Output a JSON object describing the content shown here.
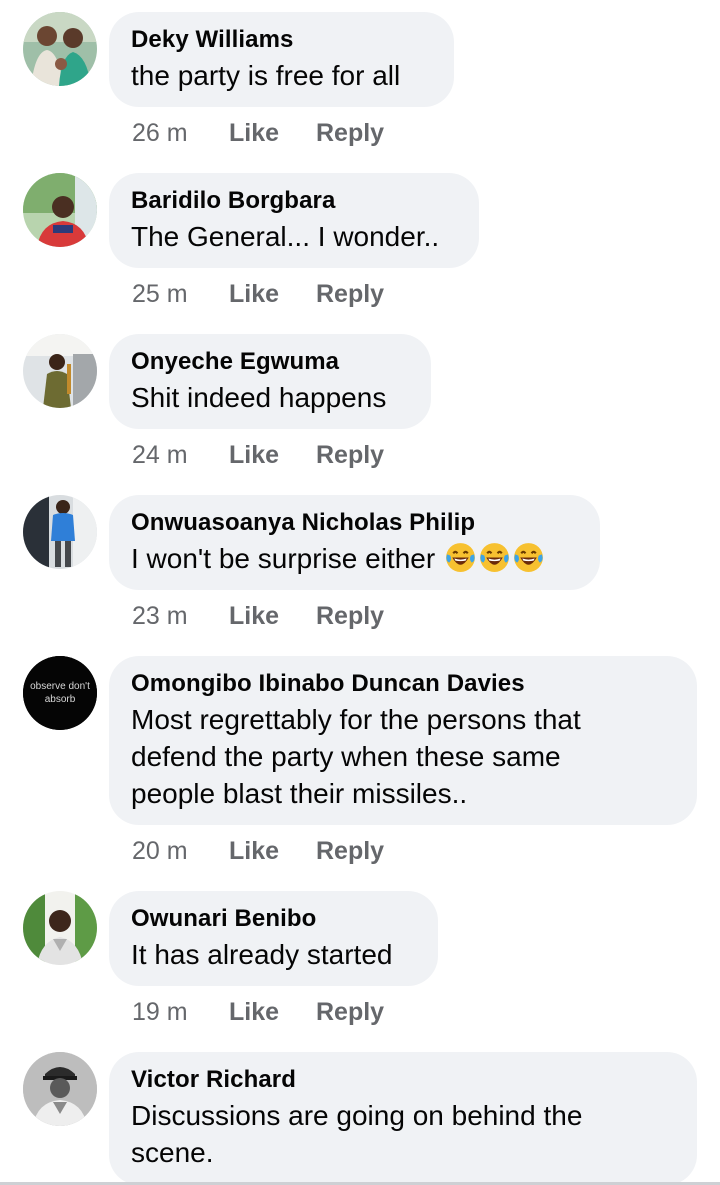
{
  "comments": [
    {
      "author": "Deky Williams",
      "text": "the party is free for all",
      "time": "26 m",
      "like": "Like",
      "reply": "Reply",
      "avatar": "avatar-couple-photo"
    },
    {
      "author": "Baridilo Borgbara",
      "text": "The General... I wonder..",
      "time": "25 m",
      "like": "Like",
      "reply": "Reply",
      "avatar": "avatar-man-outdoor-photo"
    },
    {
      "author": "Onyeche Egwuma",
      "text": "Shit indeed happens",
      "time": "24 m",
      "like": "Like",
      "reply": "Reply",
      "avatar": "avatar-man-standing-photo"
    },
    {
      "author": "Onwuasoanya Nicholas Philip",
      "text": "I won't be surprise either",
      "time": "23 m",
      "like": "Like",
      "reply": "Reply",
      "avatar": "avatar-man-blue-shirt-photo",
      "emoji": [
        "laughing-tears-emoji",
        "laughing-tears-emoji",
        "laughing-tears-emoji"
      ]
    },
    {
      "author": "Omongibo Ibinabo Duncan Davies",
      "text_lines": [
        "Most regrettably for the persons that",
        "defend the party when these same",
        "people blast their missiles.."
      ],
      "time": "20 m",
      "like": "Like",
      "reply": "Reply",
      "avatar": "avatar-black-text-logo",
      "avatar_text": [
        "observe don't",
        "absorb"
      ]
    },
    {
      "author": "Owunari Benibo",
      "text": "It has already started",
      "time": "19 m",
      "like": "Like",
      "reply": "Reply",
      "avatar": "avatar-man-green-background-photo"
    },
    {
      "author": "Victor Richard",
      "text_lines": [
        "Discussions are going on behind the",
        "scene."
      ],
      "avatar": "avatar-uniformed-officer-photo"
    }
  ],
  "colors": {
    "bubble": "#f0f2f5",
    "meta_text": "#65676b",
    "primary_text": "#050505"
  }
}
